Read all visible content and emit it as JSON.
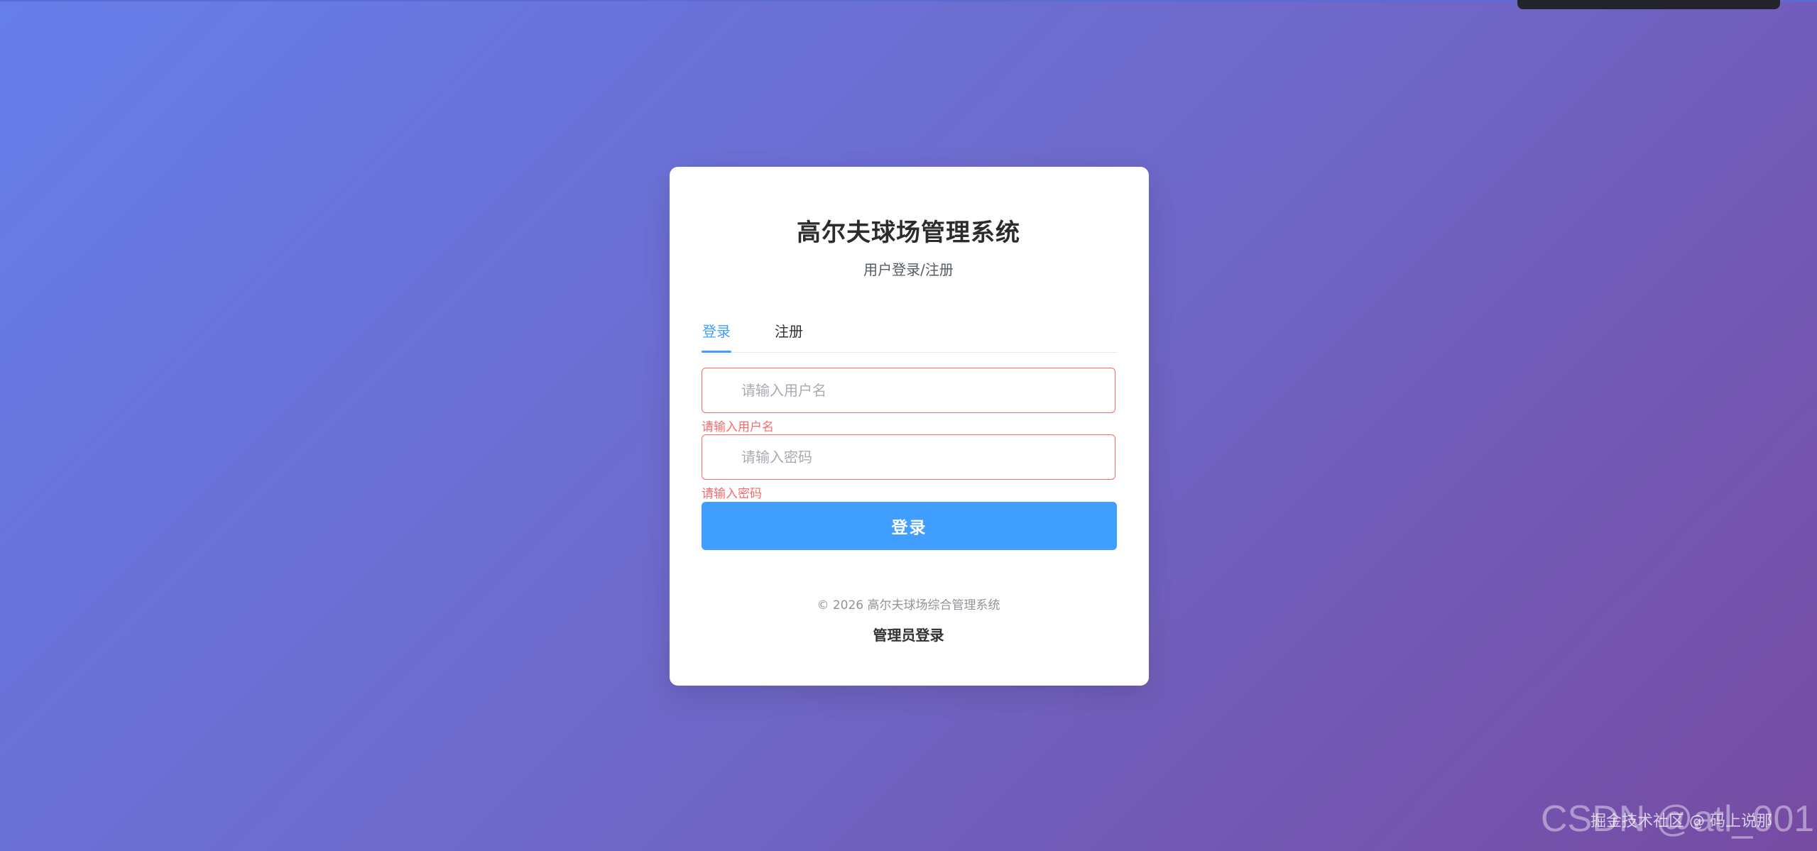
{
  "page": {
    "title": "高尔夫球场管理系统",
    "subtitle": "用户登录/注册"
  },
  "tabs": [
    {
      "label": "登录",
      "active": true
    },
    {
      "label": "注册",
      "active": false
    }
  ],
  "form": {
    "username": {
      "value": "",
      "placeholder": "请输入用户名",
      "error": "请输入用户名"
    },
    "password": {
      "value": "",
      "placeholder": "请输入密码",
      "error": "请输入密码"
    },
    "submit_label": "登录"
  },
  "footer": {
    "copyright": "© 2026 高尔夫球场综合管理系统",
    "admin_link": "管理员登录"
  },
  "watermark": {
    "cn": "掘金技术社区 @ 码上说那",
    "en": "CSDN @atl_001"
  },
  "colors": {
    "accent": "#409eff",
    "error": "#f56c6c",
    "bg_gradient_start": "#667eea",
    "bg_gradient_end": "#764ba2"
  }
}
